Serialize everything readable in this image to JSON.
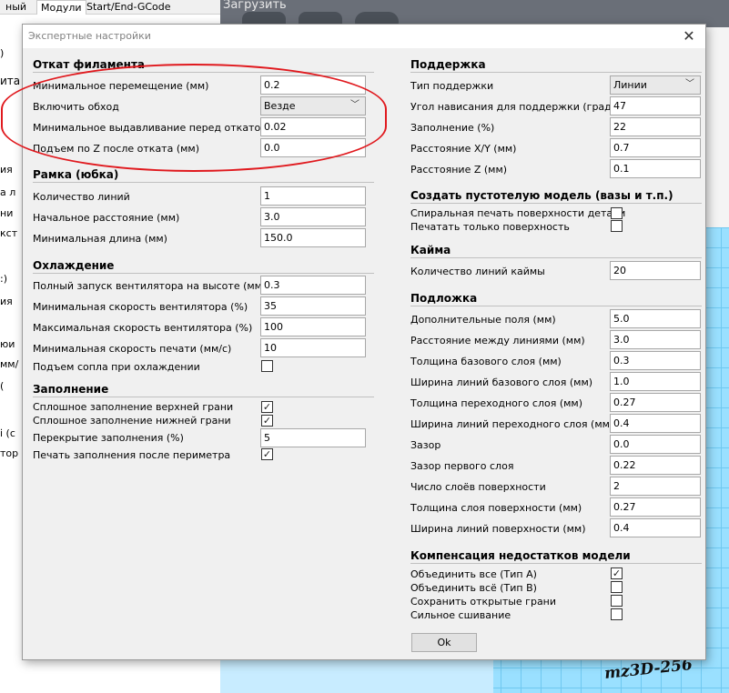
{
  "background": {
    "tabs": [
      "ный",
      "Модули",
      "Start/End-GCode"
    ],
    "load_label": "Загрузить",
    "left_fragments": [
      ")",
      "ита",
      "ия",
      "а л",
      "ни",
      "кст",
      ":)",
      "ия",
      "юи",
      "мм/",
      "(",
      "і (с",
      "тор"
    ]
  },
  "watermark": "mz3D-256",
  "dialog": {
    "title": "Экспертные настройки",
    "close": "✕",
    "ok": "Ok",
    "left": {
      "retraction": {
        "title": "Откат филамента",
        "rows": [
          {
            "label": "Минимальное перемещение (мм)",
            "value": "0.2"
          },
          {
            "label": "Включить обход",
            "value": "Везде"
          },
          {
            "label": "Минимальное выдавливание перед откатом (мм)",
            "value": "0.02"
          },
          {
            "label": "Подъем по Z после отката (мм)",
            "value": "0.0"
          }
        ]
      },
      "skirt": {
        "title": "Рамка (юбка)",
        "rows": [
          {
            "label": "Количество линий",
            "value": "1"
          },
          {
            "label": "Начальное расстояние (мм)",
            "value": "3.0"
          },
          {
            "label": "Минимальная длина (мм)",
            "value": "150.0"
          }
        ]
      },
      "cooling": {
        "title": "Охлаждение",
        "rows": [
          {
            "label": "Полный запуск вентилятора на высоте (мм)",
            "value": "0.3"
          },
          {
            "label": "Минимальная скорость вентилятора (%)",
            "value": "35"
          },
          {
            "label": "Максимальная скорость вентилятора (%)",
            "value": "100"
          },
          {
            "label": "Минимальная скорость печати (мм/с)",
            "value": "10"
          }
        ],
        "checkbox_label": "Подъем сопла при охлаждении",
        "checkbox_checked": false
      },
      "infill": {
        "title": "Заполнение",
        "top_label": "Сплошное заполнение верхней грани",
        "top_checked": true,
        "bottom_label": "Сплошное заполнение нижней грани",
        "bottom_checked": true,
        "overlap_label": "Перекрытие заполнения (%)",
        "overlap_value": "5",
        "after_label": "Печать заполнения после периметра",
        "after_checked": true
      }
    },
    "right": {
      "support": {
        "title": "Поддержка",
        "rows": [
          {
            "label": "Тип поддержки",
            "value": "Линии"
          },
          {
            "label": "Угол нависания для поддержки (градусы)",
            "value": "47"
          },
          {
            "label": "Заполнение (%)",
            "value": "22"
          },
          {
            "label": "Расстояние X/Y (мм)",
            "value": "0.7"
          },
          {
            "label": "Расстояние Z (мм)",
            "value": "0.1"
          }
        ]
      },
      "hollow": {
        "title": "Создать пустотелую модель (вазы и т.п.)",
        "spiral_label": "Спиральная печать поверхности детали",
        "spiral_checked": false,
        "surface_label": "Печатать только поверхность",
        "surface_checked": false
      },
      "brim": {
        "title": "Кайма",
        "rows": [
          {
            "label": "Количество линий каймы",
            "value": "20"
          }
        ]
      },
      "raft": {
        "title": "Подложка",
        "rows": [
          {
            "label": "Дополнительные поля (мм)",
            "value": "5.0"
          },
          {
            "label": "Расстояние между линиями (мм)",
            "value": "3.0"
          },
          {
            "label": "Толщина базового слоя (мм)",
            "value": "0.3"
          },
          {
            "label": "Ширина линий базового слоя (мм)",
            "value": "1.0"
          },
          {
            "label": "Толщина переходного слоя (мм)",
            "value": "0.27"
          },
          {
            "label": "Ширина линий переходного слоя (мм)",
            "value": "0.4"
          },
          {
            "label": "Зазор",
            "value": "0.0"
          },
          {
            "label": "Зазор первого слоя",
            "value": "0.22"
          },
          {
            "label": "Число слоёв поверхности",
            "value": "2"
          },
          {
            "label": "Толщина слоя поверхности (мм)",
            "value": "0.27"
          },
          {
            "label": "Ширина линий поверхности (мм)",
            "value": "0.4"
          }
        ]
      },
      "fix": {
        "title": "Компенсация недостатков модели",
        "items": [
          {
            "label": "Объединить все (Тип A)",
            "checked": true
          },
          {
            "label": "Объединить всё (Тип B)",
            "checked": false
          },
          {
            "label": "Сохранить открытые грани",
            "checked": false
          },
          {
            "label": "Сильное сшивание",
            "checked": false
          }
        ]
      }
    }
  }
}
